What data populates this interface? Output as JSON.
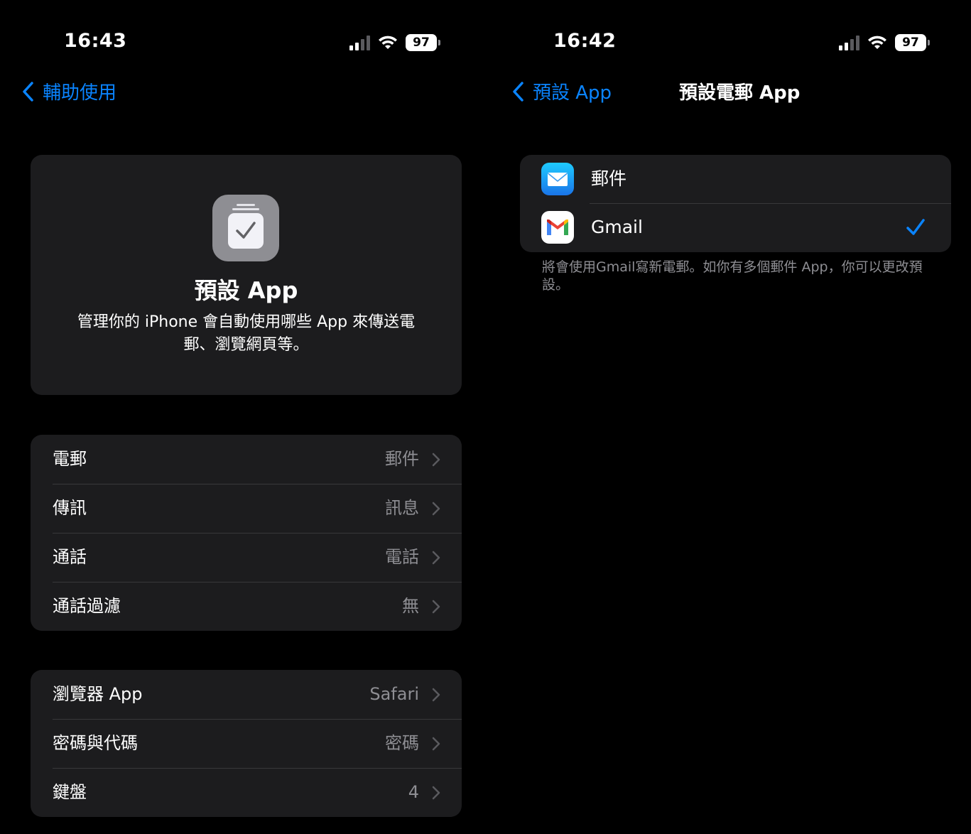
{
  "colors": {
    "background": "#000000",
    "card": "#1c1c1e",
    "separator": "#38383a",
    "accent": "#0a84ff",
    "secondary_text": "#8e8e93"
  },
  "left": {
    "status": {
      "time": "16:43",
      "battery": "97"
    },
    "nav": {
      "back_label": "輔助使用"
    },
    "header": {
      "icon": "checklist-icon",
      "title": "預設 App",
      "description": "管理你的 iPhone 會自動使用哪些 App 來傳送電郵、瀏覽網頁等。"
    },
    "groups": [
      {
        "rows": [
          {
            "label": "電郵",
            "value": "郵件"
          },
          {
            "label": "傳訊",
            "value": "訊息"
          },
          {
            "label": "通話",
            "value": "電話"
          },
          {
            "label": "通話過濾",
            "value": "無"
          }
        ]
      },
      {
        "rows": [
          {
            "label": "瀏覽器 App",
            "value": "Safari"
          },
          {
            "label": "密碼與代碼",
            "value": "密碼"
          },
          {
            "label": "鍵盤",
            "value": "4"
          }
        ]
      }
    ]
  },
  "right": {
    "status": {
      "time": "16:42",
      "battery": "97"
    },
    "nav": {
      "back_label": "預設 App",
      "title": "預設電郵 App"
    },
    "options": [
      {
        "label": "郵件",
        "icon": "mail-app-icon",
        "selected": false
      },
      {
        "label": "Gmail",
        "icon": "gmail-app-icon",
        "selected": true
      }
    ],
    "footnote": "將會使用Gmail寫新電郵。如你有多個郵件 App，你可以更改預設。"
  }
}
